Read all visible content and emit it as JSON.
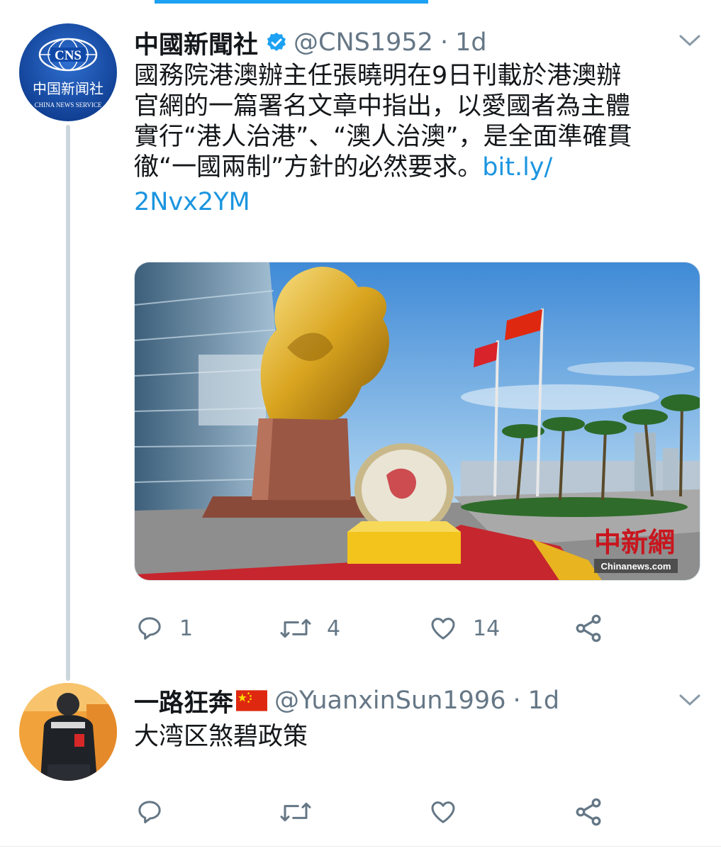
{
  "tweet1": {
    "display_name": "中國新聞社",
    "handle": "@CNS1952",
    "separator": "·",
    "time": "1d",
    "text_lines": [
      "國務院港澳辦主任張曉明在9日刊載於港澳辦",
      "官網的一篇署名文章中指出，以愛國者為主體",
      "實行“港人治港”、“澳人治澳”，是全面準確貫",
      "徹“一國兩制”方針的必然要求。"
    ],
    "link_part1": "bit.ly/",
    "link_part2": "2Nvx2YM",
    "avatar_logo": "CNS",
    "avatar_cn": "中国新闻社",
    "avatar_en": "CHINA NEWS SERVICE",
    "watermark_cn": "中新網",
    "watermark_en": "Chinanews.com",
    "replies": "1",
    "retweets": "4",
    "likes": "14"
  },
  "tweet2": {
    "display_name": "一路狂奔",
    "flag": "china-flag-emoji",
    "handle": "@YuanxinSun1996",
    "separator": "·",
    "time": "1d",
    "text": "大湾区煞碧政策"
  },
  "colors": {
    "accent": "#1da1f2",
    "link": "#1b95e0",
    "muted": "#657786",
    "line": "#ccd6dd"
  }
}
